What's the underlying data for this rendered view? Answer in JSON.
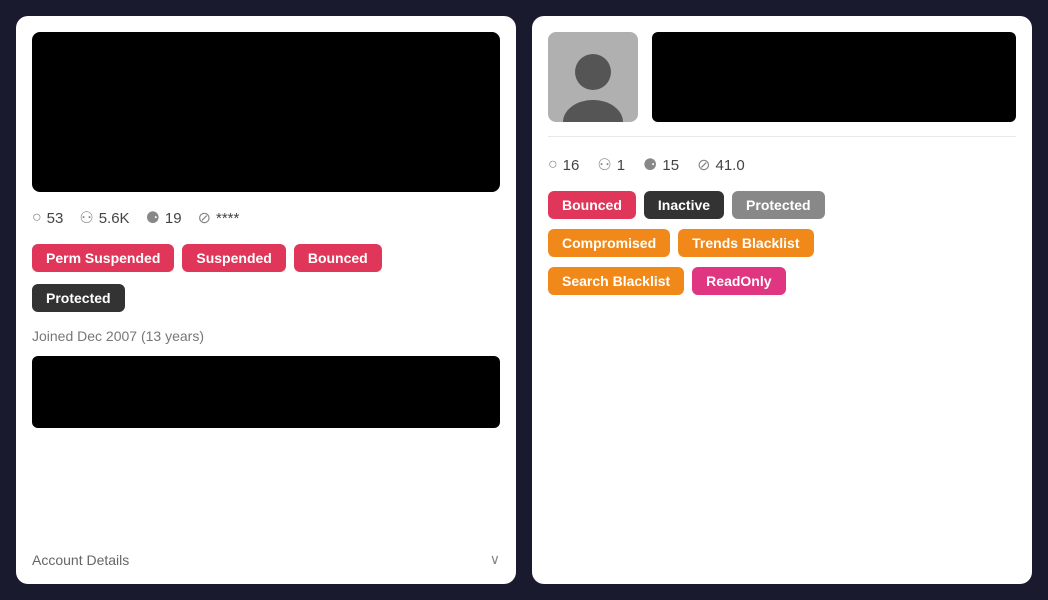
{
  "leftCard": {
    "stats": [
      {
        "icon": "💬",
        "value": "53",
        "name": "comments-stat"
      },
      {
        "icon": "👥",
        "value": "5.6K",
        "name": "followers-stat"
      },
      {
        "icon": "👤",
        "value": "19",
        "name": "following-stat"
      },
      {
        "icon": "🚫",
        "value": "****",
        "name": "blocked-stat"
      }
    ],
    "badges": [
      {
        "label": "Perm Suspended",
        "color": "badge-red",
        "name": "perm-suspended-badge"
      },
      {
        "label": "Suspended",
        "color": "badge-red",
        "name": "suspended-badge"
      },
      {
        "label": "Bounced",
        "color": "badge-red",
        "name": "bounced-badge"
      },
      {
        "label": "Protected",
        "color": "badge-dark",
        "name": "protected-badge"
      }
    ],
    "joined": "Joined Dec 2007 (13 years)",
    "accountDetailsLabel": "Account Details"
  },
  "rightCard": {
    "stats": [
      {
        "icon": "💬",
        "value": "16",
        "name": "comments-stat-right"
      },
      {
        "icon": "👥",
        "value": "1",
        "name": "followers-stat-right"
      },
      {
        "icon": "👤",
        "value": "15",
        "name": "following-stat-right"
      },
      {
        "icon": "🚫",
        "value": "41.0",
        "name": "blocked-stat-right"
      }
    ],
    "badgeRows": [
      [
        {
          "label": "Bounced",
          "color": "badge-red",
          "name": "bounced-badge-right"
        },
        {
          "label": "Inactive",
          "color": "badge-dark",
          "name": "inactive-badge"
        },
        {
          "label": "Protected",
          "color": "badge-gray",
          "name": "protected-badge-right"
        }
      ],
      [
        {
          "label": "Compromised",
          "color": "badge-orange",
          "name": "compromised-badge"
        },
        {
          "label": "Trends Blacklist",
          "color": "badge-orange",
          "name": "trends-blacklist-badge"
        }
      ],
      [
        {
          "label": "Search Blacklist",
          "color": "badge-orange",
          "name": "search-blacklist-badge"
        },
        {
          "label": "ReadOnly",
          "color": "badge-pink",
          "name": "readonly-badge"
        }
      ]
    ]
  },
  "icons": {
    "chevron": "∨",
    "comment": "○",
    "followers": "⚇",
    "following": "⚈",
    "blocked": "⊘"
  }
}
